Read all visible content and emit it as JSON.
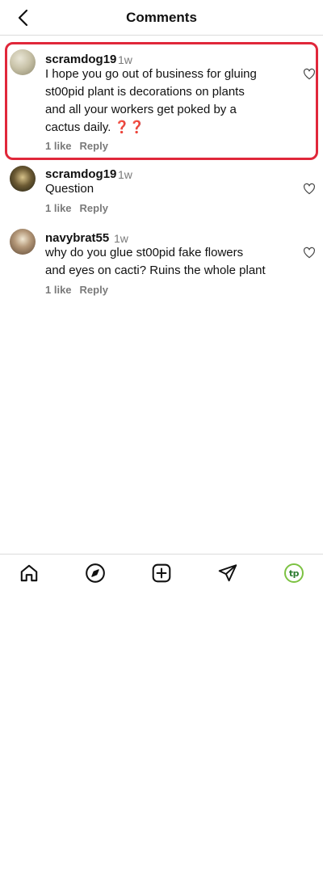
{
  "header": {
    "title": "Comments"
  },
  "comments": [
    {
      "username": "scramdog19",
      "time": "1w",
      "lines": [
        "I hope you go out of business for gluing",
        "st00pid plant is decorations on plants",
        "and all your workers get poked by a",
        "cactus daily. ❓❓"
      ],
      "likes": "1 like",
      "reply": "Reply",
      "highlighted": true
    },
    {
      "username": "scramdog19",
      "time": "1w",
      "lines": [
        "Question"
      ],
      "likes": "1 like",
      "reply": "Reply"
    },
    {
      "username": "navybrat55",
      "time": "1w",
      "lines": [
        "why do you glue st00pid fake flowers",
        "and eyes on cacti? Ruins the whole plant"
      ],
      "likes": "1 like",
      "reply": "Reply"
    }
  ],
  "nav": {
    "items": [
      "home-icon",
      "explore-icon",
      "create-icon",
      "messages-icon",
      "profile-avatar"
    ],
    "profile_initials": "tp",
    "profile_color": "#7cc242"
  },
  "colors": {
    "highlight_border": "#e0273a",
    "muted_text": "#7a7a7a"
  }
}
